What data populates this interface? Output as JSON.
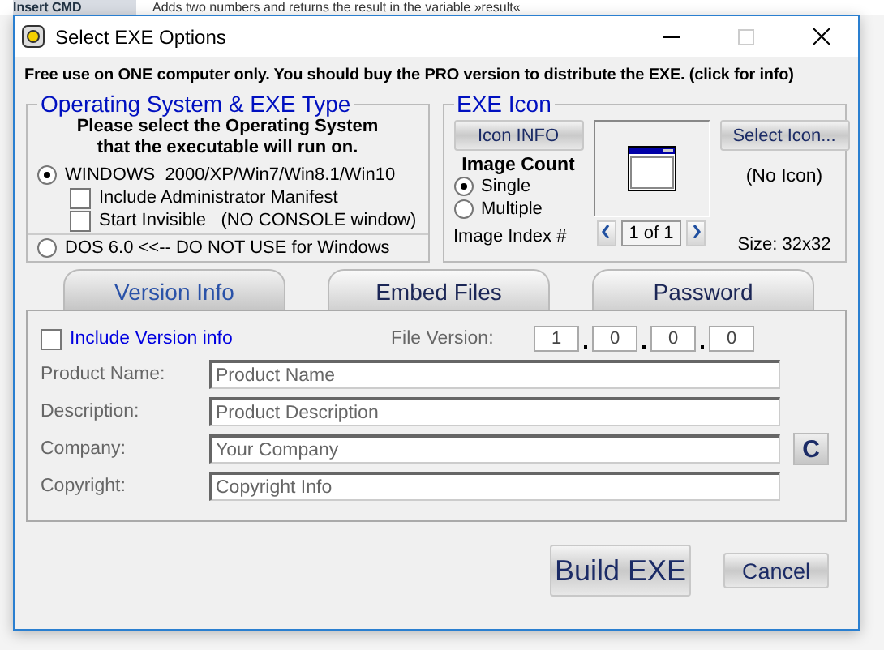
{
  "background": {
    "button": "Insert CMD",
    "text": "Adds two numbers and returns the result in the variable »result«"
  },
  "window": {
    "title": "Select EXE Options"
  },
  "notice": "Free use on ONE computer only. You should buy the PRO version to distribute the EXE. (click for info)",
  "os_group": {
    "title": "Operating System & EXE Type",
    "prompt": "Please select the Operating System that the executable will run on.",
    "options": [
      {
        "label": "WINDOWS  2000/XP/Win7/Win8.1/Win10",
        "selected": true,
        "checkboxes": [
          {
            "label": "Include Administrator Manifest",
            "checked": false
          },
          {
            "label": "Start Invisible   (NO CONSOLE window)",
            "checked": false
          }
        ]
      },
      {
        "label": "DOS 6.0 <<-- DO NOT USE for Windows",
        "selected": false
      }
    ]
  },
  "icon_group": {
    "title": "EXE Icon",
    "info_button": "Icon INFO",
    "image_count_label": "Image Count",
    "image_count_options": [
      {
        "label": "Single",
        "selected": true
      },
      {
        "label": "Multiple",
        "selected": false
      }
    ],
    "image_index_label": "Image Index #",
    "image_index": "1 of 1",
    "select_button": "Select Icon...",
    "icon_name": "(No Icon)",
    "size": "Size: 32x32"
  },
  "tabs": [
    {
      "label": "Version Info",
      "selected": true
    },
    {
      "label": "Embed Files",
      "selected": false
    },
    {
      "label": "Password",
      "selected": false
    }
  ],
  "version_info": {
    "include": {
      "label": "Include Version info",
      "checked": false
    },
    "file_version_label": "File Version:",
    "file_version": [
      "1",
      "0",
      "0",
      "0"
    ],
    "fields": [
      {
        "label": "Product Name:",
        "placeholder": "Product Name"
      },
      {
        "label": "Description:",
        "placeholder": "Product Description"
      },
      {
        "label": "Company:",
        "placeholder": "Your Company"
      },
      {
        "label": "Copyright:",
        "placeholder": "Copyright Info"
      }
    ],
    "side_button": "C"
  },
  "buttons": [
    {
      "label": "Build EXE",
      "kind": "primary"
    },
    {
      "label": "Cancel",
      "kind": "secondary"
    }
  ]
}
